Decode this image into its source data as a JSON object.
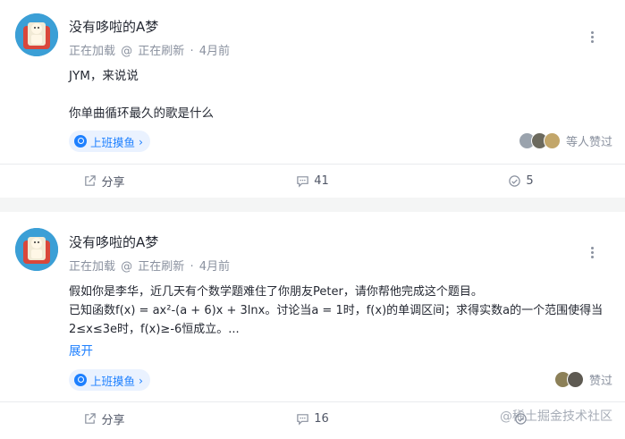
{
  "posts": [
    {
      "author": "没有哆啦的A梦",
      "meta": {
        "job": "正在加载",
        "at": "@",
        "company": "正在刷新",
        "dot": "·",
        "time": "4月前"
      },
      "lines": [
        "JYM，来说说",
        "",
        "你单曲循环最久的歌是什么"
      ],
      "topic": "上班摸鱼",
      "topic_chevron": "›",
      "likers_label": "等人赞过",
      "actions": {
        "share": "分享",
        "comments": "41",
        "likes": "5"
      }
    },
    {
      "author": "没有哆啦的A梦",
      "meta": {
        "job": "正在加载",
        "at": "@",
        "company": "正在刷新",
        "dot": "·",
        "time": "4月前"
      },
      "lines": [
        "假如你是李华，近几天有个数学题难住了你朋友Peter，请你帮他完成这个题目。",
        "已知函数f(x) = ax²-(a + 6)x + 3lnx。讨论当a = 1时，f(x)的单调区间；求得实数a的一个范围使得当",
        "2≤x≤3e时，f(x)≥-6恒成立。..."
      ],
      "expand": "展开",
      "topic": "上班摸鱼",
      "topic_chevron": "›",
      "likers_label": "赞过",
      "actions": {
        "share": "分享",
        "comments": "16"
      }
    }
  ],
  "watermark": "@稀土掘金技术社区",
  "colors": {
    "accent": "#1e80ff",
    "muted": "#8a919f",
    "background": "#f4f5f5"
  },
  "icons": [
    "avatar-image",
    "more-icon",
    "topic-icon",
    "share-icon",
    "comment-icon",
    "like-icon"
  ]
}
